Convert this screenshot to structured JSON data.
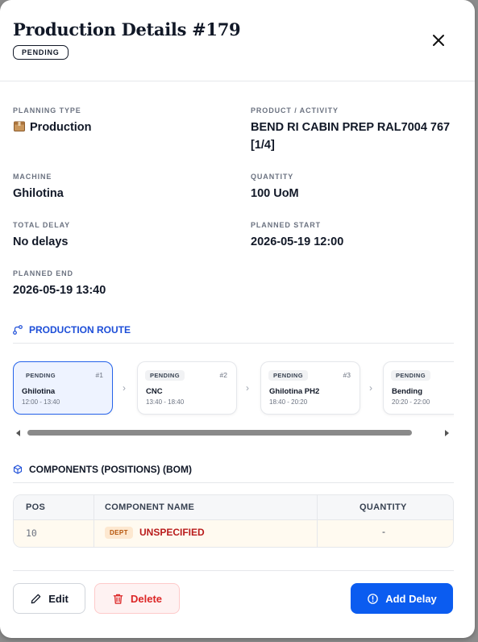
{
  "header": {
    "title": "Production Details #179",
    "status": "PENDING"
  },
  "details": {
    "planning_type": {
      "label": "PLANNING TYPE",
      "value": "Production",
      "icon": "package-icon"
    },
    "product": {
      "label": "PRODUCT / ACTIVITY",
      "value_line1": "BEND RI CABIN PREP RAL7004 767",
      "value_line2": "[1/4]"
    },
    "machine": {
      "label": "MACHINE",
      "value": "Ghilotina"
    },
    "quantity": {
      "label": "QUANTITY",
      "value": "100 UoM"
    },
    "total_delay": {
      "label": "TOTAL DELAY",
      "value": "No delays"
    },
    "planned_start": {
      "label": "PLANNED START",
      "value": "2026-05-19 12:00"
    },
    "planned_end": {
      "label": "PLANNED END",
      "value": "2026-05-19 13:40"
    }
  },
  "route": {
    "title": "PRODUCTION ROUTE",
    "steps": [
      {
        "status": "PENDING",
        "num": "#1",
        "machine": "Ghilotina",
        "time": "12:00 - 13:40",
        "active": true
      },
      {
        "status": "PENDING",
        "num": "#2",
        "machine": "CNC",
        "time": "13:40 - 18:40",
        "active": false
      },
      {
        "status": "PENDING",
        "num": "#3",
        "machine": "Ghilotina PH2",
        "time": "18:40 - 20:20",
        "active": false
      },
      {
        "status": "PENDING",
        "num": "#4",
        "machine": "Bending",
        "time": "20:20 - 22:00",
        "active": false
      }
    ]
  },
  "components": {
    "title": "COMPONENTS (POSITIONS) (BOM)",
    "headers": {
      "pos": "POS",
      "name": "COMPONENT NAME",
      "quantity": "QUANTITY"
    },
    "rows": [
      {
        "pos": "10",
        "badge": "DEPT",
        "name": "UNSPECIFIED",
        "quantity": "-"
      }
    ]
  },
  "footer": {
    "edit": "Edit",
    "delete": "Delete",
    "add_delay": "Add Delay"
  },
  "colors": {
    "primary": "#0b5cf0",
    "danger": "#dc2626",
    "route_accent": "#1d4ed8"
  }
}
